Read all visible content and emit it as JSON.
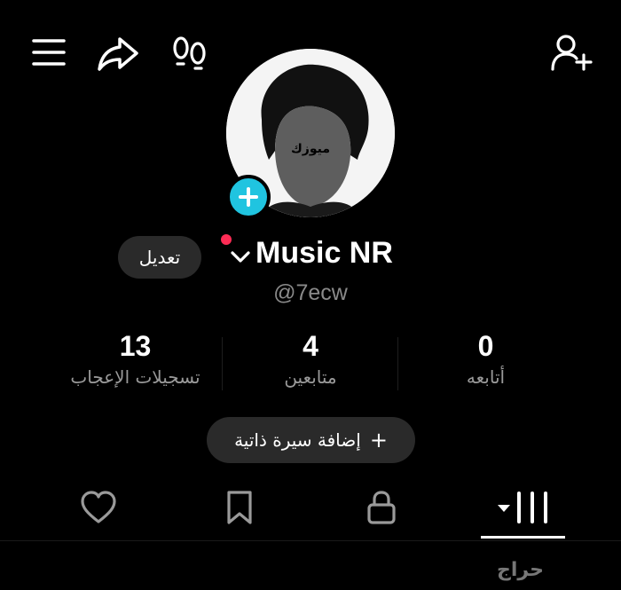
{
  "profile": {
    "display_name": "Music NR",
    "handle": "@7ecw",
    "edit_label": "تعديل",
    "avatar_text": "ميوزك"
  },
  "stats": [
    {
      "value": "13",
      "label": "تسجيلات الإعجاب"
    },
    {
      "value": "4",
      "label": "متابعين"
    },
    {
      "value": "0",
      "label": "أتابعه"
    }
  ],
  "bio_button": {
    "label": "إضافة سيرة ذاتية",
    "plus": "+"
  },
  "colors": {
    "accent_blue": "#20c4e0",
    "notification_red": "#fe2c55",
    "background": "#000000"
  },
  "tabs": [
    "heart-icon",
    "bookmark-icon",
    "lock-icon",
    "grid-icon"
  ],
  "watermark": "حراج"
}
